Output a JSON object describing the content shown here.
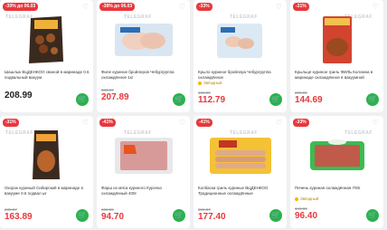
{
  "watermark": "TELEGRAF",
  "products": [
    {
      "badge": "-30% до 06.03",
      "title": "Шашлык ВЦДЕНКОО свиной в маринаде 0.6 подвальный вакуум",
      "mark": "",
      "old_price": "",
      "price": "208.99",
      "sale": false
    },
    {
      "badge": "-38% до 06.03",
      "title": "Филе куриное бройлеров Чебургруппа охлаждённое 1кг",
      "mark": "",
      "old_price": "339.97",
      "price": "207.89",
      "sale": true
    },
    {
      "badge": "-33%",
      "title": "Крыло куриное бройлера Чебургруппа охлаждённое",
      "mark": "Звёздный",
      "old_price": "169.99",
      "price": "112.79",
      "sale": true
    },
    {
      "badge": "-31%",
      "title": "Крыльце куриное гриль ФИЛЬ Коломна в маринаде охлаждённое в вакуумной упаковке",
      "mark": "",
      "old_price": "209.99",
      "price": "144.69",
      "sale": true
    },
    {
      "badge": "-31%",
      "title": "Окорок куриный Сибирский в маринаде в вакууме 0.6 подвал ыг",
      "mark": "",
      "old_price": "239.97",
      "price": "163.89",
      "sale": true
    },
    {
      "badge": "-41%",
      "title": "Фарш из мяса куриного Курочка охлаждённый 400г",
      "mark": "",
      "old_price": "159.99",
      "price": "94.70",
      "sale": true
    },
    {
      "badge": "-41%",
      "title": "Колбаски гриль куриные ВЦДЕНКОО Традиционные охлаждённые",
      "mark": "",
      "old_price": "299.97",
      "price": "177.40",
      "sale": true
    },
    {
      "badge": "-33%",
      "title": "Печень куриная охлаждённая 700г",
      "mark": "Звёздный",
      "old_price": "144.89",
      "price": "96.40",
      "sale": true
    }
  ],
  "colors": {
    "accent": "#e8383d",
    "cart": "#2bb24c"
  }
}
